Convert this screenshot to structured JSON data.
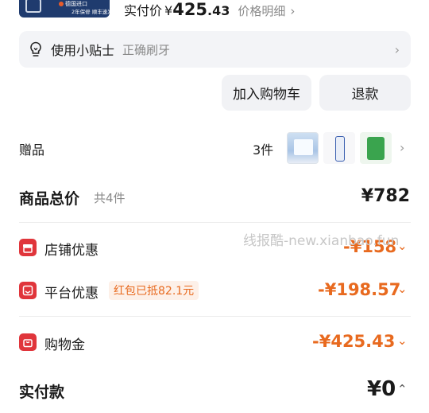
{
  "product_banner": {
    "line1": "德国进口",
    "line2": "2年保修  顺丰速发"
  },
  "paid_summary": {
    "label": "实付价",
    "currency": "¥",
    "amount_int": "425",
    "amount_dec": ".43",
    "detail_link": "价格明细",
    "chevron": "›"
  },
  "tip": {
    "icon": "lightbulb-icon",
    "label": "使用小贴士",
    "value": "正确刷牙",
    "chevron": "›"
  },
  "actions": {
    "add_to_cart": "加入购物车",
    "refund": "退款"
  },
  "gifts": {
    "label": "赠品",
    "count": "3件",
    "chevron": "›"
  },
  "total": {
    "label": "商品总价",
    "sub": "共4件",
    "value": "¥782"
  },
  "discounts": [
    {
      "icon": "shop-icon",
      "label": "店铺优惠",
      "value": "-¥158",
      "chevron": "⌄"
    },
    {
      "icon": "platform-icon",
      "label": "平台优惠",
      "tag": "红包已抵82.1元",
      "value": "-¥198.57",
      "chevron": "⌄"
    },
    {
      "icon": "shopping-bag-icon",
      "label": "购物金",
      "value": "-¥425.43",
      "chevron": "⌄"
    }
  ],
  "watermark": "线报酷-new.xianbao.fun",
  "payment": {
    "label": "实付款",
    "value": "¥0",
    "chevron": "⌃"
  },
  "colors": {
    "accent": "#e86a1f",
    "icon_red": "#e0353b",
    "muted": "#8a8a8a",
    "panel": "#f3f4f7"
  }
}
